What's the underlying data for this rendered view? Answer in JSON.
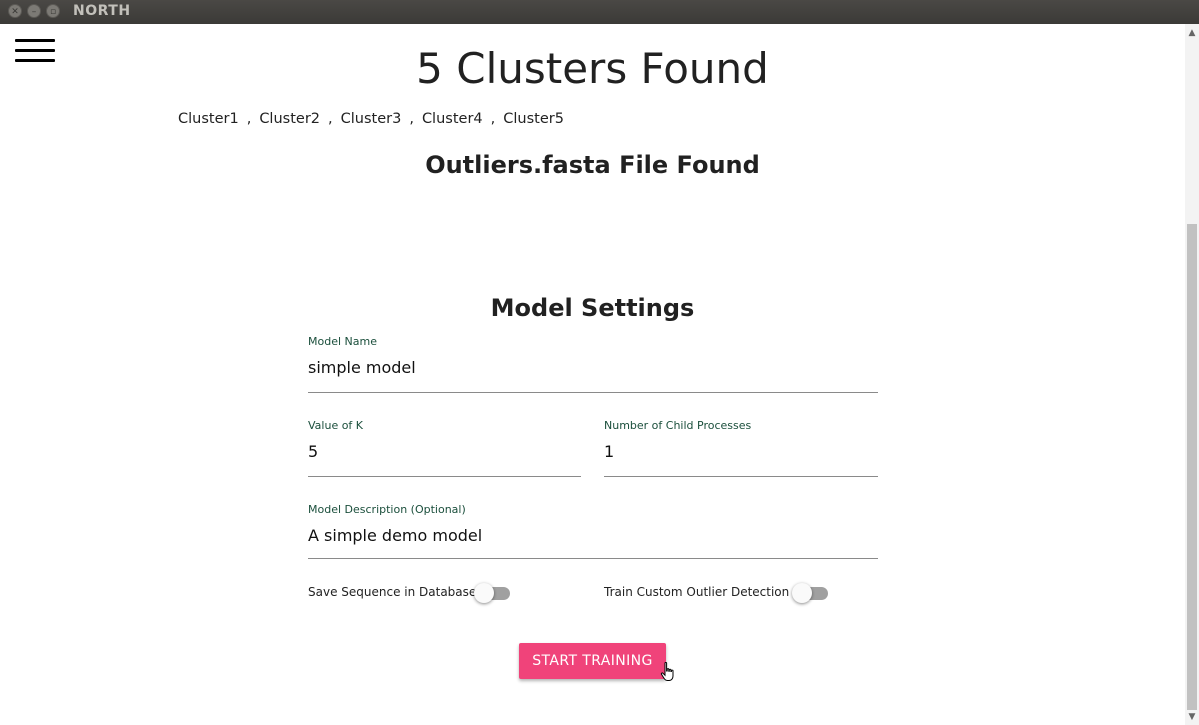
{
  "window": {
    "title": "NORTH"
  },
  "header": {
    "headline": "5 Clusters Found",
    "clusters": [
      "Cluster1",
      "Cluster2",
      "Cluster3",
      "Cluster4",
      "Cluster5"
    ],
    "separator": ",",
    "outliers_message": "Outliers.fasta File Found"
  },
  "settings": {
    "title": "Model Settings",
    "model_name": {
      "label": "Model Name",
      "value": "simple model"
    },
    "k_value": {
      "label": "Value of K",
      "value": "5"
    },
    "child_processes": {
      "label": "Number of Child Processes",
      "value": "1"
    },
    "description": {
      "label": "Model Description (Optional)",
      "value": "A simple demo model"
    },
    "save_sequence": {
      "label": "Save Sequence in Database",
      "checked": false
    },
    "custom_outlier": {
      "label": "Train Custom Outlier Detection",
      "checked": false
    },
    "start_button": "START TRAINING"
  },
  "colors": {
    "accent": "#f0437a",
    "label_text": "#1b4f3c",
    "toggle_off_track": "#a0a0a0"
  },
  "icons": {
    "menu": "hamburger-menu-icon",
    "cursor": "hand-pointer-icon"
  }
}
